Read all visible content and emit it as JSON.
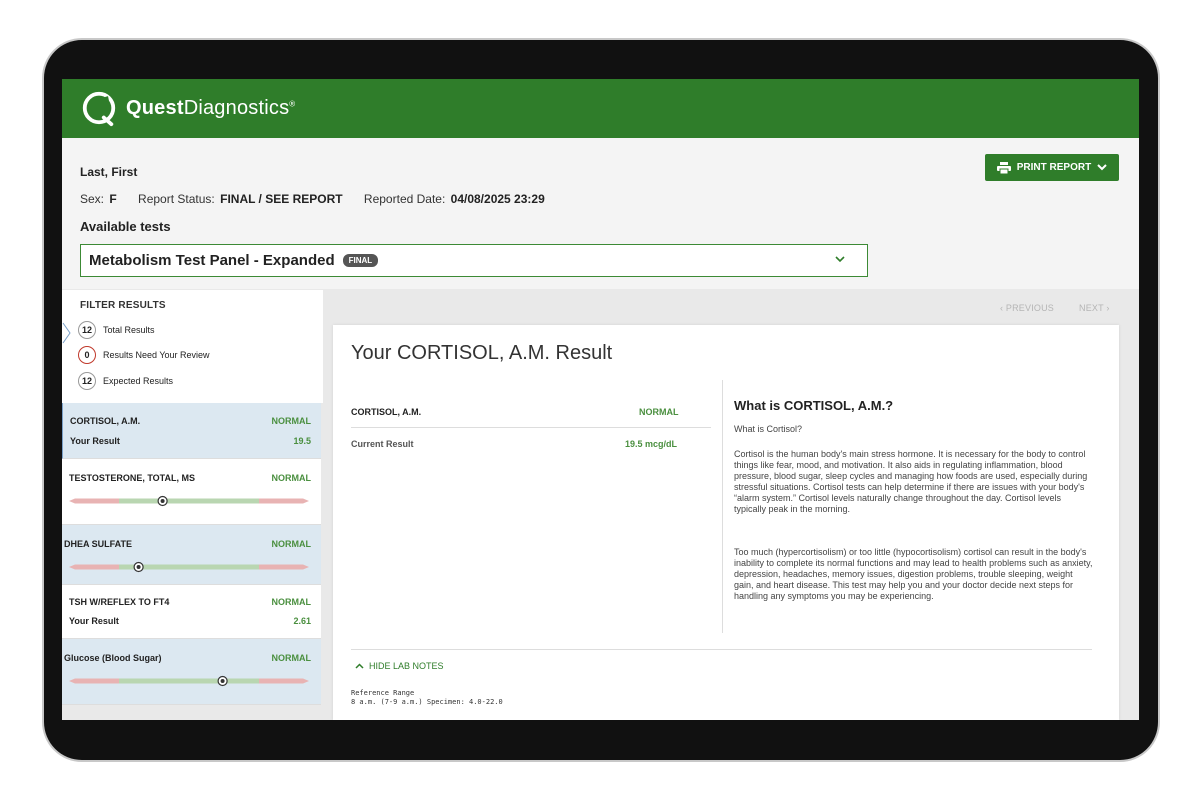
{
  "brand": {
    "logo_bold": "Quest",
    "logo_light": "Diagnostics",
    "logo_reg": "®",
    "header_color": "#2f7d2a"
  },
  "patient": {
    "name": "Last, First",
    "sex_label": "Sex:",
    "sex_value": "F",
    "status_label": "Report Status:",
    "status_value": "FINAL / SEE REPORT",
    "date_label": "Reported Date:",
    "date_value": "04/08/2025 23:29"
  },
  "toolbar": {
    "print_label": "PRINT REPORT",
    "print_icon": "printer-icon"
  },
  "tests": {
    "heading": "Available tests",
    "selected": "Metabolism Test Panel - Expanded",
    "badge": "FINAL"
  },
  "filter": {
    "title": "FILTER RESULTS",
    "rows": [
      {
        "count": "12",
        "label": "Total Results"
      },
      {
        "count": "0",
        "label": "Results Need Your Review"
      },
      {
        "count": "12",
        "label": "Expected Results"
      }
    ]
  },
  "results": [
    {
      "name": "CORTISOL, A.M.",
      "status": "NORMAL",
      "sub_label": "Your Result",
      "value": "19.5"
    },
    {
      "name": "TESTOSTERONE, TOTAL, MS",
      "status": "NORMAL",
      "marker_fraction": 0.39
    },
    {
      "name": "DHEA SULFATE",
      "status": "NORMAL",
      "marker_fraction": 0.29
    },
    {
      "name": "TSH W/REFLEX TO FT4",
      "status": "NORMAL",
      "sub_label": "Your Result",
      "value": "2.61"
    },
    {
      "name": "Glucose (Blood Sugar)",
      "status": "NORMAL",
      "marker_fraction": 0.64
    }
  ],
  "pager": {
    "previous": "‹ PREVIOUS",
    "next": "NEXT ›"
  },
  "detail": {
    "title": "Your CORTISOL, A.M. Result",
    "test_label": "CORTISOL, A.M.",
    "test_status": "NORMAL",
    "current_label": "Current Result",
    "current_value": "19.5 mcg/dL",
    "what_title": "What is CORTISOL, A.M.?",
    "what_sub": "What is Cortisol?",
    "what_p1": "Cortisol is the human body's main stress hormone. It is necessary for the body to control things like fear, mood, and motivation. It also aids in regulating inflammation, blood pressure, blood sugar, sleep cycles and managing how foods are used, especially during stressful situations. Cortisol tests can help determine if there are issues with your body's “alarm system.” Cortisol levels naturally change throughout the day. Cortisol levels typically peak in the morning.",
    "what_p2": "Too much (hypercortisolism) or too little (hypocortisolism) cortisol can result in the body's inability to complete its normal functions and may lead to health problems such as anxiety, depression, headaches, memory issues, digestion problems, trouble sleeping, weight gain, and heart disease. This test may help you and your doctor decide next steps for handling any symptoms you may be experiencing.",
    "hide_notes": "HIDE LAB NOTES",
    "ref_range": "Reference Range\n8 a.m. (7-9 a.m.) Specimen: 4.0-22.0"
  },
  "colors": {
    "accent": "#2f7d2a",
    "normal": "#4a8f3f",
    "range_green": "#b9d6b1",
    "range_red": "#e8b3b3",
    "selected_bg": "#dce8f1"
  }
}
